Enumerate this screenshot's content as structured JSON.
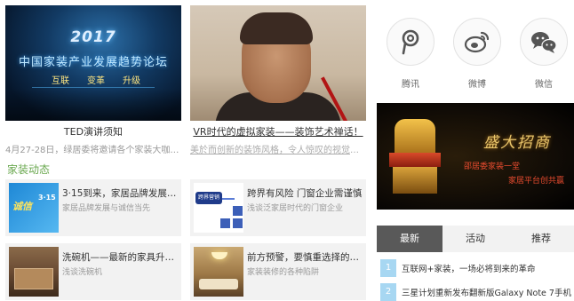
{
  "features": [
    {
      "caption": "TED演讲须知",
      "subtitle": "4月27-28日，绿居委将邀请各个家装大咖为…",
      "poster": {
        "year": "2017",
        "title": "中国家装产业发展趋势论坛",
        "keywords": [
          "互联",
          "变革",
          "升级"
        ]
      }
    },
    {
      "caption": "VR时代的虚拟家装——装饰艺术禅话！",
      "subtitle": "美於而创新的装饰风格，令人惊叹的视觉效…"
    }
  ],
  "section": {
    "title": "家装动态"
  },
  "news": [
    {
      "title": "3·15到来，家居品牌发展…",
      "desc": "家居品牌发展与诚信当先",
      "thumb": {
        "t1": "诚信",
        "t2": "3·15"
      }
    },
    {
      "title": "跨界有风险 门窗企业需谨慎",
      "desc": "浅谈泛家居时代的门窗企业",
      "thumb": {
        "label": "跨界营销"
      }
    },
    {
      "title": "洗碗机——最新的家具升级热",
      "desc": "浅谈洗碗机"
    },
    {
      "title": "前方预警，要慎重选择的几…",
      "desc": "家装装修的各种陷阱"
    }
  ],
  "share": [
    {
      "label": "腾讯",
      "icon": "tencent-icon"
    },
    {
      "label": "微博",
      "icon": "weibo-icon"
    },
    {
      "label": "微信",
      "icon": "wechat-icon"
    }
  ],
  "banner": {
    "headline": "盛大招商",
    "line1": "邵居委家装一堂",
    "line2": "家居平台创共赢"
  },
  "tabs": [
    {
      "label": "最新",
      "active": true
    },
    {
      "label": "活动",
      "active": false
    },
    {
      "label": "推荐",
      "active": false
    }
  ],
  "latest": [
    {
      "num": "1",
      "text": "互联网+家装，一场必将到来的革命"
    },
    {
      "num": "2",
      "text": "三星计划重新发布翻新版Galaxy Note 7手机"
    }
  ],
  "colors": {
    "section_green": "#6aa84f",
    "tab_active": "#595959",
    "list_number_bg": "#a7d7f2"
  }
}
